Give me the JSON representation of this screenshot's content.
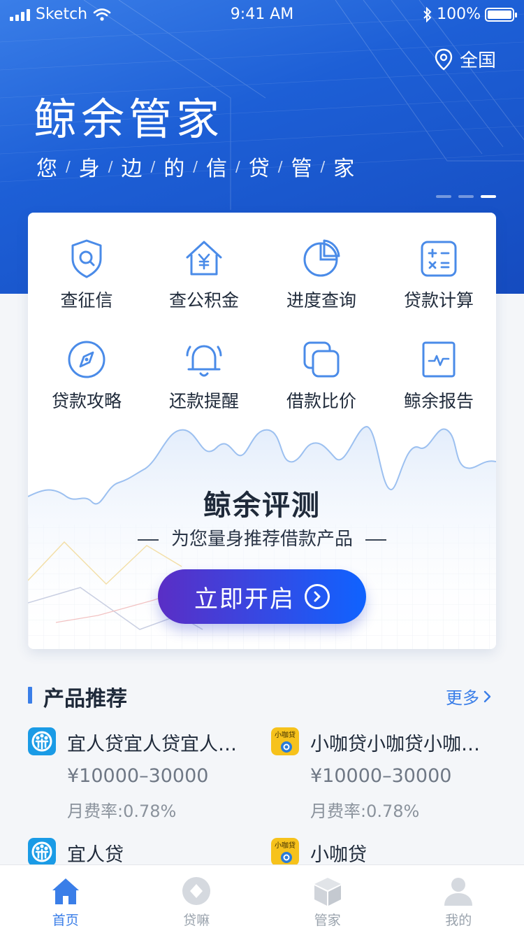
{
  "status_bar": {
    "carrier": "Sketch",
    "time": "9:41 AM",
    "battery": "100%"
  },
  "header": {
    "location": "全国",
    "title": "鲸余管家",
    "slogan": [
      "您",
      "身",
      "边",
      "的",
      "信",
      "贷",
      "管",
      "家"
    ],
    "carousel": {
      "count": 3,
      "active_index": 2
    }
  },
  "services": [
    {
      "label": "查征信",
      "icon": "credit-shield-icon"
    },
    {
      "label": "查公积金",
      "icon": "housing-fund-icon"
    },
    {
      "label": "进度查询",
      "icon": "pie-progress-icon"
    },
    {
      "label": "贷款计算",
      "icon": "calculator-icon"
    },
    {
      "label": "贷款攻略",
      "icon": "compass-icon"
    },
    {
      "label": "还款提醒",
      "icon": "bell-icon"
    },
    {
      "label": "借款比价",
      "icon": "compare-icon"
    },
    {
      "label": "鲸余报告",
      "icon": "report-icon"
    }
  ],
  "evaluation": {
    "title": "鲸余评测",
    "subtitle": "为您量身推荐借款产品",
    "cta": "立即开启"
  },
  "products_section": {
    "title": "产品推荐",
    "more": "更多"
  },
  "products": [
    {
      "name": "宜人贷宜人贷宜人贷宜人贷",
      "amount": "¥10000–30000",
      "rate": "月费率:0.78%",
      "logo": "yirendai-logo"
    },
    {
      "name": "小咖贷小咖贷小咖贷小咖贷",
      "amount": "¥10000–30000",
      "rate": "月费率:0.78%",
      "logo": "xiaokadai-logo"
    },
    {
      "name": "宜人贷",
      "amount": "",
      "rate": "",
      "logo": "yirendai-logo"
    },
    {
      "name": "小咖贷",
      "amount": "",
      "rate": "",
      "logo": "xiaokadai-logo"
    }
  ],
  "logo_text": {
    "xiaokadai": "小咖贷"
  },
  "tabbar": [
    {
      "label": "首页",
      "icon": "home-icon",
      "active": true
    },
    {
      "label": "贷嘛",
      "icon": "loan-icon",
      "active": false
    },
    {
      "label": "管家",
      "icon": "box-icon",
      "active": false
    },
    {
      "label": "我的",
      "icon": "user-icon",
      "active": false
    }
  ],
  "colors": {
    "primary": "#3a7ee8",
    "hero_dark": "#154bbf",
    "cta_start": "#5a2ec5",
    "cta_end": "#0f63ff",
    "icon_blue": "#4a8be8"
  }
}
